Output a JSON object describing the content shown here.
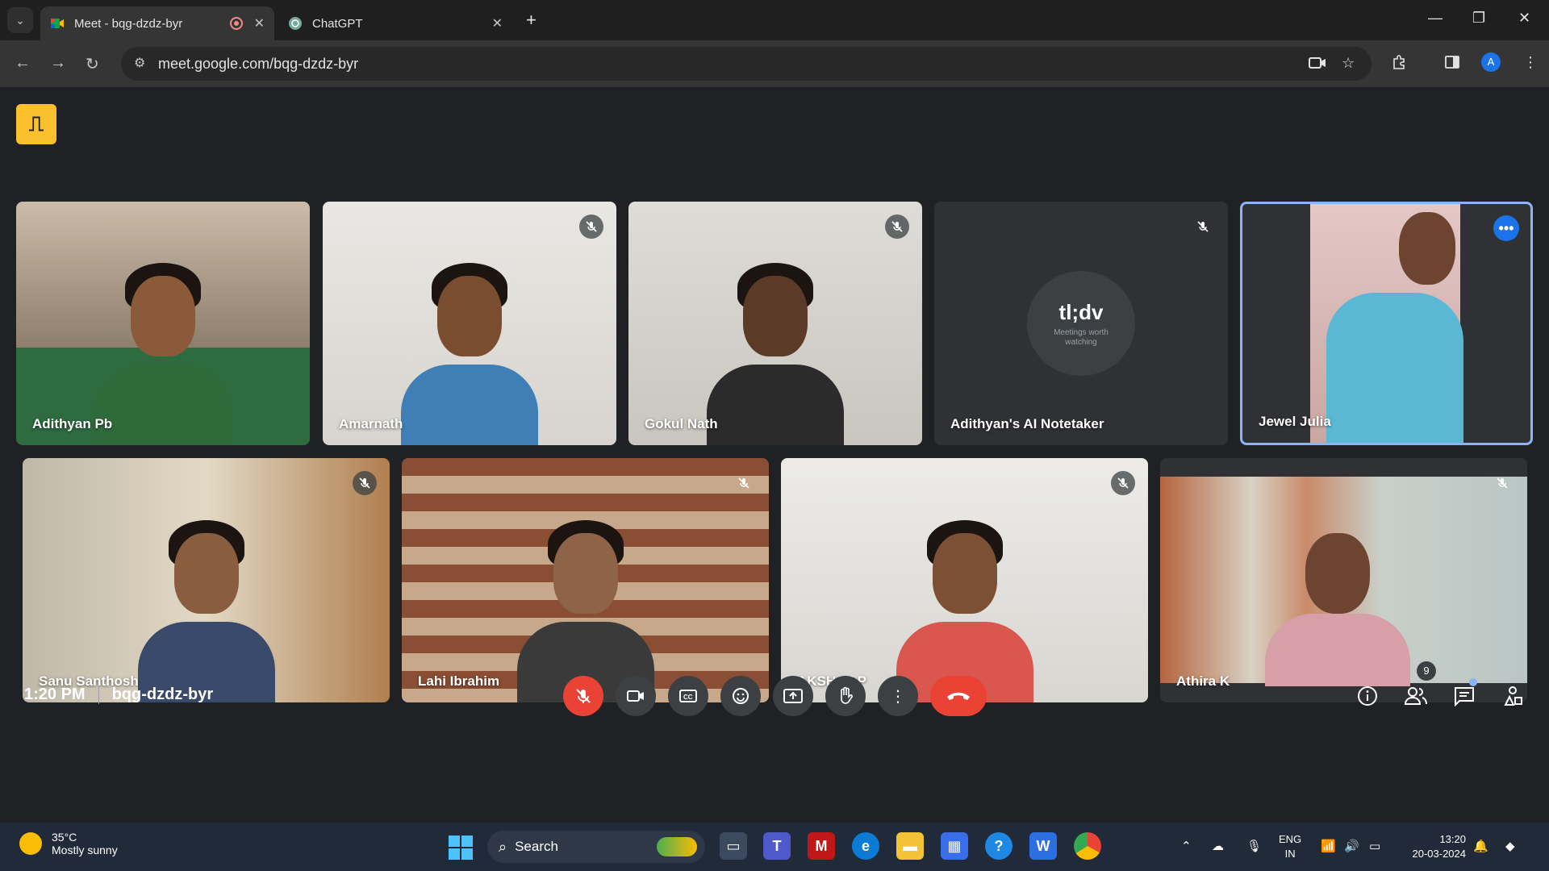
{
  "browser": {
    "tabs": [
      {
        "title": "Meet - bqg-dzdz-byr",
        "active": true
      },
      {
        "title": "ChatGPT",
        "active": false
      }
    ],
    "new_tab": "+",
    "url": "meet.google.com/bqg-dzdz-byr",
    "profile_initial": "A"
  },
  "meet": {
    "participants": [
      {
        "name": "Adithyan Pb",
        "muted": false
      },
      {
        "name": "Amarnath",
        "muted": true
      },
      {
        "name": "Gokul Nath",
        "muted": true
      },
      {
        "name": "Adithyan's AI Notetaker",
        "muted": true
      },
      {
        "name": "Jewel Julia",
        "muted": false,
        "active_speaker": true
      },
      {
        "name": "Sanu Santhosh",
        "muted": true
      },
      {
        "name": "Lahi Ibrahim",
        "muted": true
      },
      {
        "name": "AKSHAY P",
        "muted": true
      },
      {
        "name": "Athira K",
        "muted": true
      }
    ],
    "notetaker": {
      "brand": "tl;dv",
      "tagline": "Meetings worth watching"
    },
    "time": "1:20 PM",
    "meeting_code": "bqg-dzdz-byr",
    "people_count": "9",
    "colors": {
      "accent": "#8ab4f8",
      "danger": "#ea4335",
      "control_bg": "#3c4043",
      "bg": "#202124"
    }
  },
  "taskbar": {
    "weather_temp": "35°C",
    "weather_condition": "Mostly sunny",
    "search_label": "Search",
    "lang_line1": "ENG",
    "lang_line2": "IN",
    "time": "13:20",
    "date": "20-03-2024"
  }
}
